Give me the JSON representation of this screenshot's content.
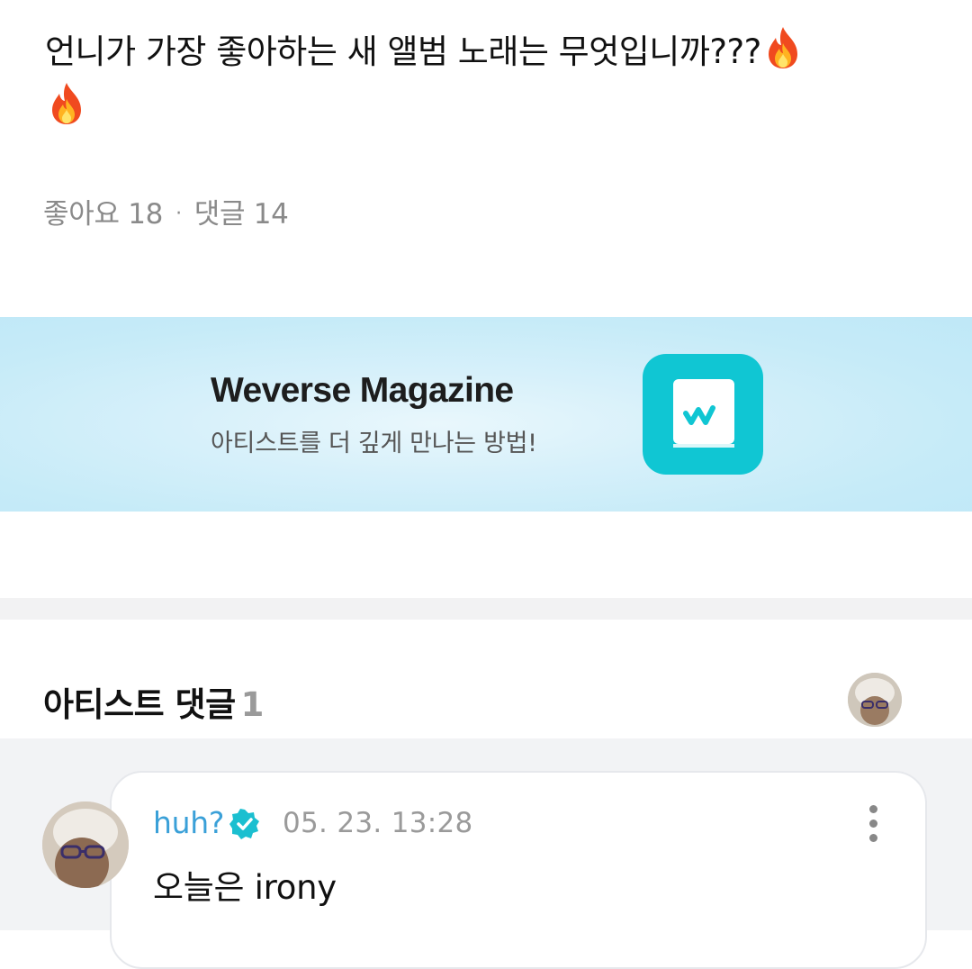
{
  "post": {
    "text": "언니가 가장 좋아하는 새 앨범 노래는 무엇입니까???",
    "icons": [
      "fire-emoji",
      "fire-emoji"
    ]
  },
  "stats": {
    "likes_label": "좋아요 18",
    "separator": "·",
    "comments_label": "댓글 14"
  },
  "banner": {
    "title": "Weverse Magazine",
    "subtitle": "아티스트를 더 깊게 만나는 방법!",
    "app_icon": "weverse-magazine-book-icon",
    "accent_color": "#10c6d3"
  },
  "artist_comments": {
    "title": "아티스트 댓글",
    "count": "1",
    "items": [
      {
        "author": "huh?",
        "verified_icon": "verified-badge-icon",
        "date": "05. 23. 13:28",
        "body": "오늘은 irony"
      }
    ]
  }
}
